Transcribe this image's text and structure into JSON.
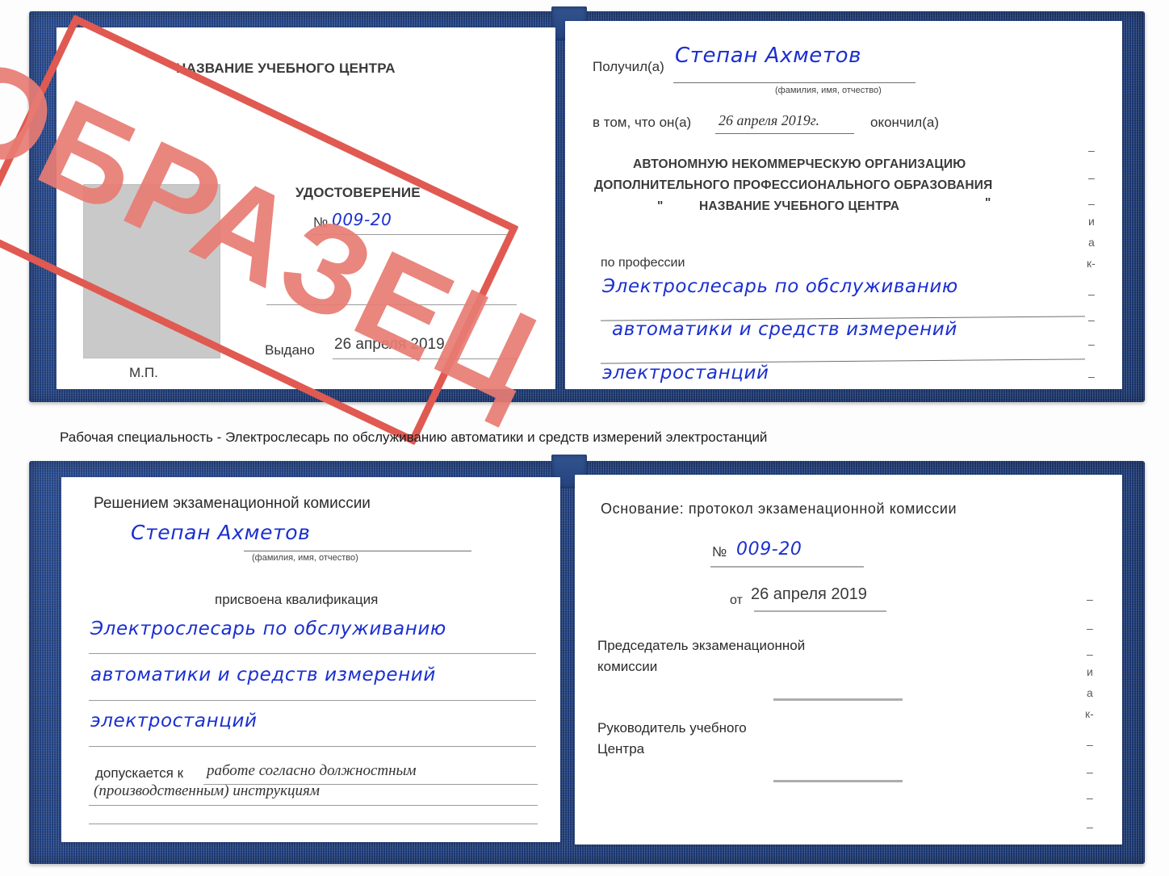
{
  "document": {
    "type": "certificate-spread",
    "title": "Удостоверение — Рабочая специальность",
    "colors": {
      "cover": "#21407f",
      "paper": "#ffffff",
      "ink_hand": "#1a2fd0",
      "stamp": "#e05a52",
      "photo_placeholder": "#c9c9c9",
      "rule": "#9a9a9a"
    }
  },
  "stamp": {
    "text": "ОБРАЗЕЦ"
  },
  "caption": {
    "text": "Рабочая специальность - Электрослесарь по обслуживанию автоматики и средств измерений электростанций"
  },
  "cert_top": {
    "left_page": {
      "heading": "НАЗВАНИЕ УЧЕБНОГО ЦЕНТРА",
      "doc_type": "УДОСТОВЕРЕНИЕ",
      "number_label": "№",
      "number_value": "009-20",
      "issued_label": "Выдано",
      "issued_value": "26 апреля 2019",
      "seal_label": "М.П.",
      "photo_placeholder": ""
    },
    "right_page": {
      "received_label": "Получил(а)",
      "received_value": "Степан Ахметов",
      "received_hint": "(фамилия, имя, отчество)",
      "in_that_label": "в том, что он(а)",
      "completion_date": "26 апреля 2019г.",
      "finished_label": "окончил(а)",
      "org_line1": "АВТОНОМНУЮ НЕКОММЕРЧЕСКУЮ ОРГАНИЗАЦИЮ",
      "org_line2": "ДОПОЛНИТЕЛЬНОГО ПРОФЕССИОНАЛЬНОГО ОБРАЗОВАНИЯ",
      "org_quote_open": "\"",
      "org_line3": "НАЗВАНИЕ УЧЕБНОГО ЦЕНТРА",
      "org_quote_close": "\"",
      "profession_label": "по профессии",
      "profession_line1": "Электрослесарь по обслуживанию",
      "profession_line2": "автоматики и средств измерений",
      "profession_line3": "электростанций",
      "edge_fragments": [
        "–",
        "–",
        "–",
        "и",
        "а",
        "к-",
        "–",
        "–",
        "–",
        "–"
      ]
    }
  },
  "cert_bottom": {
    "left_page": {
      "heading": "Решением экзаменационной комиссии",
      "name_value": "Степан Ахметов",
      "name_hint": "(фамилия, имя, отчество)",
      "qualification_label": "присвоена квалификация",
      "qualification_line1": "Электрослесарь по обслуживанию",
      "qualification_line2": "автоматики и средств измерений",
      "qualification_line3": "электростанций",
      "allowed_label": "допускается к",
      "allowed_value_line1": "работе согласно должностным",
      "allowed_value_line2": "(производственным) инструкциям"
    },
    "right_page": {
      "basis_label": "Основание: протокол экзаменационной комиссии",
      "number_label": "№",
      "number_value": "009-20",
      "date_label": "от",
      "date_value": "26 апреля 2019",
      "chairman_line1": "Председатель экзаменационной",
      "chairman_line2": "комиссии",
      "head_line1": "Руководитель учебного",
      "head_line2": "Центра",
      "edge_fragments": [
        "–",
        "–",
        "–",
        "и",
        "а",
        "к-",
        "–",
        "–",
        "–",
        "–"
      ]
    }
  }
}
